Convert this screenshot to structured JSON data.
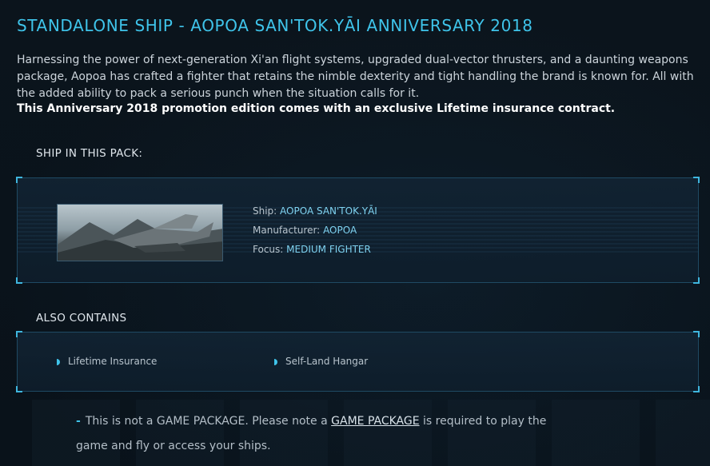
{
  "title": "STANDALONE SHIP - AOPOA SAN'TOK.YĀI ANNIVERSARY 2018",
  "description": "Harnessing the power of next-generation Xi'an flight systems, upgraded dual-vector thrusters, and a daunting weapons package, Aopoa has crafted a fighter that retains the nimble dexterity and tight handling the brand is known for. All with the added ability to pack a serious punch when the situation calls for it.",
  "promo": "This Anniversary 2018 promotion edition comes with an exclusive Lifetime insurance contract.",
  "ship_section": {
    "label": "SHIP IN THIS PACK:",
    "ship_label": "Ship:",
    "ship_value": "AOPOA SAN'TOK.YĀI",
    "manufacturer_label": "Manufacturer:",
    "manufacturer_value": "AOPOA",
    "focus_label": "Focus:",
    "focus_value": "MEDIUM FIGHTER"
  },
  "also_contains": {
    "label": "ALSO CONTAINS",
    "items": [
      "Lifetime Insurance",
      "Self-Land Hangar"
    ]
  },
  "note": {
    "dash": "-",
    "text_before": "This is not a GAME PACKAGE. Please note a",
    "link": "GAME PACKAGE",
    "text_after": "is required to play the game and fly or access your ships."
  },
  "colors": {
    "accent": "#3fc4ea",
    "background": "#0a1219",
    "panel_border": "#1f4a63"
  }
}
